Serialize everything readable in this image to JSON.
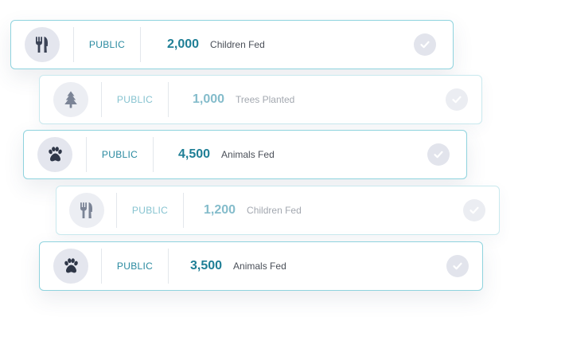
{
  "cards": [
    {
      "icon": "utensils-icon",
      "visibility": "PUBLIC",
      "count": "2,000",
      "label": "Children Fed",
      "faded": false
    },
    {
      "icon": "tree-icon",
      "visibility": "PUBLIC",
      "count": "1,000",
      "label": "Trees Planted",
      "faded": true
    },
    {
      "icon": "paw-icon",
      "visibility": "PUBLIC",
      "count": "4,500",
      "label": "Animals Fed",
      "faded": false
    },
    {
      "icon": "utensils-icon",
      "visibility": "PUBLIC",
      "count": "1,200",
      "label": "Children Fed",
      "faded": true
    },
    {
      "icon": "paw-icon",
      "visibility": "PUBLIC",
      "count": "3,500",
      "label": "Animals Fed",
      "faded": false
    }
  ],
  "colors": {
    "accent": "#1f7f96",
    "border": "#8fd3de",
    "icon": "#3b4356"
  }
}
